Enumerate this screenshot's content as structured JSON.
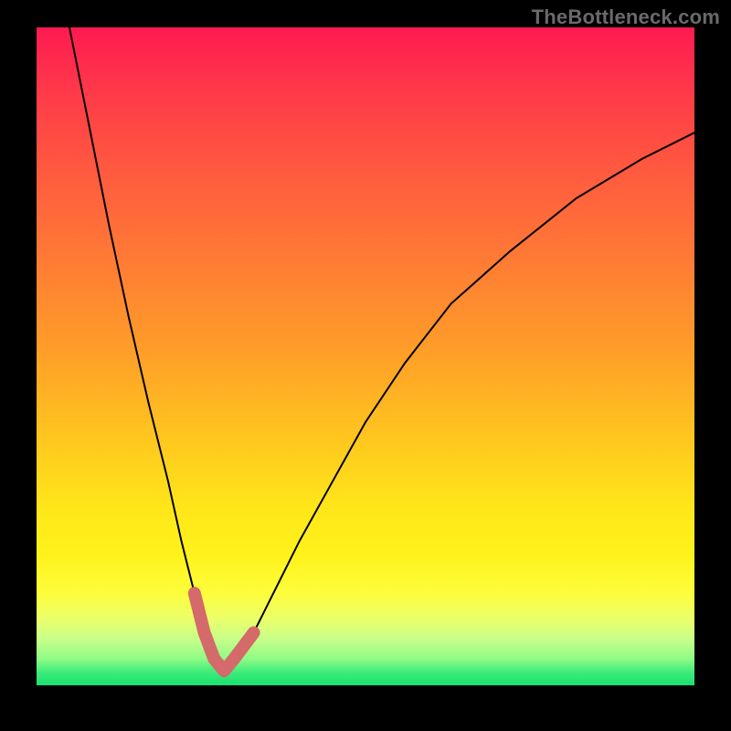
{
  "watermark": "TheBottleneck.com",
  "colors": {
    "page_bg": "#000000",
    "curve": "#000000",
    "highlight": "#d46a6a",
    "watermark_text": "#6a6a6a"
  },
  "chart_data": {
    "type": "line",
    "title": "",
    "xlabel": "",
    "ylabel": "",
    "xlim": [
      0,
      100
    ],
    "ylim": [
      0,
      100
    ],
    "grid": false,
    "legend": false,
    "series": [
      {
        "name": "bottleneck-curve",
        "x": [
          5,
          8,
          11,
          14,
          17,
          20,
          22,
          24,
          25.5,
          27,
          28.5,
          30,
          33,
          36,
          40,
          45,
          50,
          56,
          63,
          72,
          82,
          92,
          100
        ],
        "y": [
          100,
          85,
          70,
          56,
          43,
          31,
          22,
          14,
          8,
          4,
          2.2,
          4,
          8,
          14,
          22,
          31,
          40,
          49,
          58,
          66,
          74,
          80,
          84
        ]
      }
    ],
    "annotations": [
      {
        "name": "highlight-dip",
        "x": [
          24,
          25.5,
          27,
          28.5,
          30,
          31.5,
          33
        ],
        "y": [
          14,
          8,
          4,
          2.2,
          4,
          6,
          8
        ]
      }
    ]
  }
}
